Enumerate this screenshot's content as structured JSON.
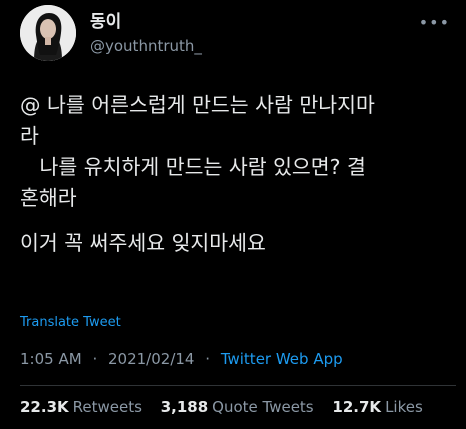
{
  "user": {
    "display_name": "동이",
    "handle": "@youthntruth_"
  },
  "more_icon": "•••",
  "tweet": {
    "lines": [
      "@ 나를 어른스럽게 만드는 사람 만나지마",
      "라",
      "   나를 유치하게 만드는 사람 있으면? 결",
      "혼해라",
      "이거 꼭 써주세요 잊지마세요"
    ]
  },
  "translate_label": "Translate Tweet",
  "meta": {
    "time": "1:05 AM",
    "date": "2021/02/14",
    "separator": "·",
    "app": "Twitter Web App"
  },
  "stats": {
    "retweets": {
      "count": "22.3K",
      "label": "Retweets"
    },
    "quotes": {
      "count": "3,188",
      "label": "Quote Tweets"
    },
    "likes": {
      "count": "12.7K",
      "label": "Likes"
    }
  },
  "colors": {
    "background": "#000000",
    "text": "#e7e9ea",
    "muted": "#8b98a5",
    "link": "#1d9bf0"
  }
}
